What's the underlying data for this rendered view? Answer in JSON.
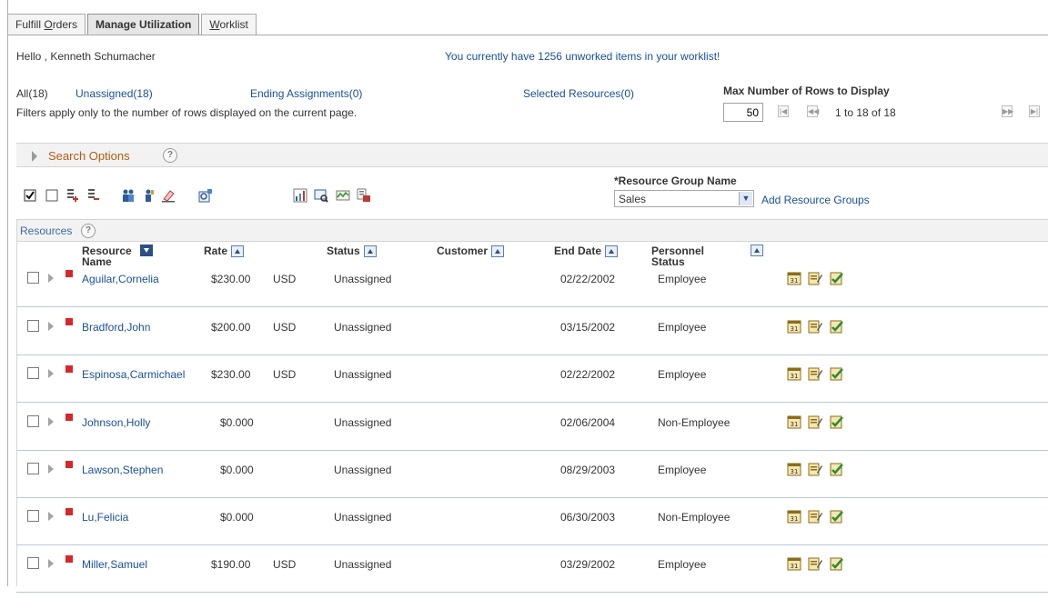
{
  "tabs": [
    {
      "label": "Fulfill Orders",
      "underline_char": "O",
      "active": false
    },
    {
      "label": "Manage Utilization",
      "active": true
    },
    {
      "label": "Worklist",
      "underline_char": "W",
      "active": false
    }
  ],
  "header": {
    "greeting": "Hello , Kenneth Schumacher",
    "worklist_message": "You currently have 1256 unworked items in your worklist!"
  },
  "filters": {
    "all": "All(18)",
    "unassigned": "Unassigned(18)",
    "ending": "Ending Assignments(0)",
    "selected": "Selected Resources(0)",
    "note": "Filters apply only to the number of rows displayed on the current page."
  },
  "paging": {
    "max_rows_label": "Max Number of Rows to Display",
    "max_rows_value": "50",
    "range": "1 to 18 of 18"
  },
  "search": {
    "label": "Search Options",
    "help": "?"
  },
  "resource_group": {
    "label": "*Resource Group Name",
    "selected": "Sales",
    "add_link": "Add Resource Groups"
  },
  "grid": {
    "title": "Resources",
    "help": "?",
    "columns": {
      "resource_name": "Resource Name",
      "rate": "Rate",
      "status": "Status",
      "customer": "Customer",
      "end_date": "End Date",
      "personnel_status": "Personnel Status"
    },
    "rows": [
      {
        "name": "Aguilar,Cornelia",
        "rate": "$230.00",
        "currency": "USD",
        "status": "Unassigned",
        "customer": "",
        "end_date": "02/22/2002",
        "personnel": "Employee"
      },
      {
        "name": "Bradford,John",
        "rate": "$200.00",
        "currency": "USD",
        "status": "Unassigned",
        "customer": "",
        "end_date": "03/15/2002",
        "personnel": "Employee"
      },
      {
        "name": "Espinosa,Carmichael",
        "rate": "$230.00",
        "currency": "USD",
        "status": "Unassigned",
        "customer": "",
        "end_date": "02/22/2002",
        "personnel": "Employee"
      },
      {
        "name": "Johnson,Holly",
        "rate": "$0.000",
        "currency": "",
        "status": "Unassigned",
        "customer": "",
        "end_date": "02/06/2004",
        "personnel": "Non-Employee"
      },
      {
        "name": "Lawson,Stephen",
        "rate": "$0.000",
        "currency": "",
        "status": "Unassigned",
        "customer": "",
        "end_date": "08/29/2003",
        "personnel": "Employee"
      },
      {
        "name": "Lu,Felicia",
        "rate": "$0.000",
        "currency": "",
        "status": "Unassigned",
        "customer": "",
        "end_date": "06/30/2003",
        "personnel": "Non-Employee"
      },
      {
        "name": "Miller,Samuel",
        "rate": "$190.00",
        "currency": "USD",
        "status": "Unassigned",
        "customer": "",
        "end_date": "03/29/2002",
        "personnel": "Employee"
      }
    ]
  },
  "icons": {
    "toolbar": [
      "check-all-icon",
      "uncheck-all-icon",
      "expand-all-icon",
      "collapse-all-icon",
      "team-icon",
      "resource-icon",
      "eraser-icon",
      "find-resource-icon",
      "utilization-chart-icon",
      "review-icon",
      "schedule-icon",
      "assign-icon"
    ],
    "row": [
      "calendar-icon",
      "notes-icon",
      "approve-icon"
    ]
  },
  "colors": {
    "link": "#1a4f99",
    "flag": "#d9262a",
    "search_label": "#b35c16",
    "row_separator": "#b8c8de"
  }
}
